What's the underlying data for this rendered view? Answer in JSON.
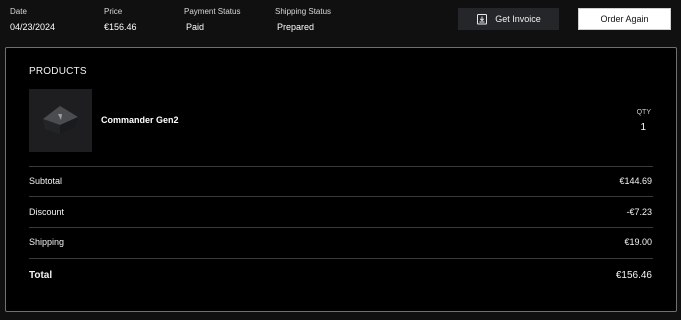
{
  "summary": {
    "date": {
      "label": "Date",
      "value": "04/23/2024"
    },
    "price": {
      "label": "Price",
      "value": "€156.46"
    },
    "payment_status": {
      "label": "Payment Status",
      "value": "Paid"
    },
    "shipping_status": {
      "label": "Shipping Status",
      "value": "Prepared"
    }
  },
  "actions": {
    "invoice_label": "Get Invoice",
    "invoice_icon": "download-document-icon",
    "order_again_label": "Order Again"
  },
  "products": {
    "title": "PRODUCTS",
    "items": [
      {
        "name": "Commander Gen2",
        "qty_label": "QTY",
        "qty": "1",
        "thumb_icon": "device-thumbnail"
      }
    ]
  },
  "totals": {
    "subtotal": {
      "label": "Subtotal",
      "value": "€144.69"
    },
    "discount": {
      "label": "Discount",
      "value": "-€7.23"
    },
    "shipping": {
      "label": "Shipping",
      "value": "€19.00"
    },
    "total": {
      "label": "Total",
      "value": "€156.46"
    }
  },
  "colors": {
    "background": "#101011",
    "card": "#000000",
    "invoice_button": "#25262a",
    "order_button": "#ffffff"
  }
}
